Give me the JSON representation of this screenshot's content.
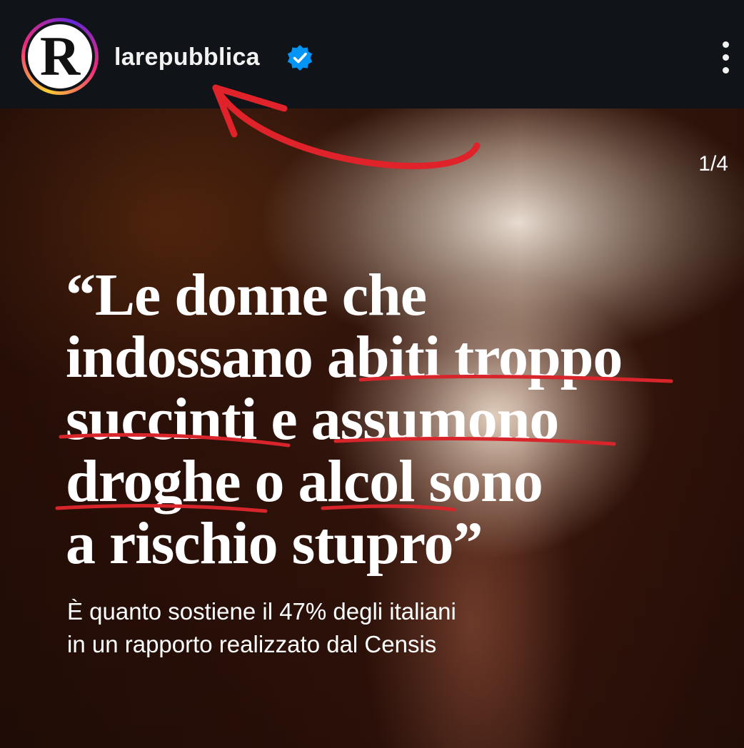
{
  "header": {
    "avatar_letter": "R",
    "username": "larepubblica",
    "verified_icon": "verified-badge-icon",
    "more_icon": "more-options-icon"
  },
  "post": {
    "counter": "1/4",
    "headline_lines": [
      "“Le donne che",
      "indossano abiti troppo",
      "succinti e assumono",
      "droghe o alcol sono",
      "a rischio stupro”"
    ],
    "subtitle_lines": [
      "È quanto sostiene il 47% degli italiani",
      "in un rapporto realizzato dal Censis"
    ]
  },
  "annotations": {
    "arrow_color": "#e0222a",
    "underline_color": "#d8252b",
    "underlined_words": [
      "abiti troppo",
      "succinti",
      "assumono",
      "droghe",
      "alcol"
    ]
  },
  "colors": {
    "header_bg": "#101418",
    "verified_blue": "#0095f6",
    "text_white": "#ffffff"
  }
}
